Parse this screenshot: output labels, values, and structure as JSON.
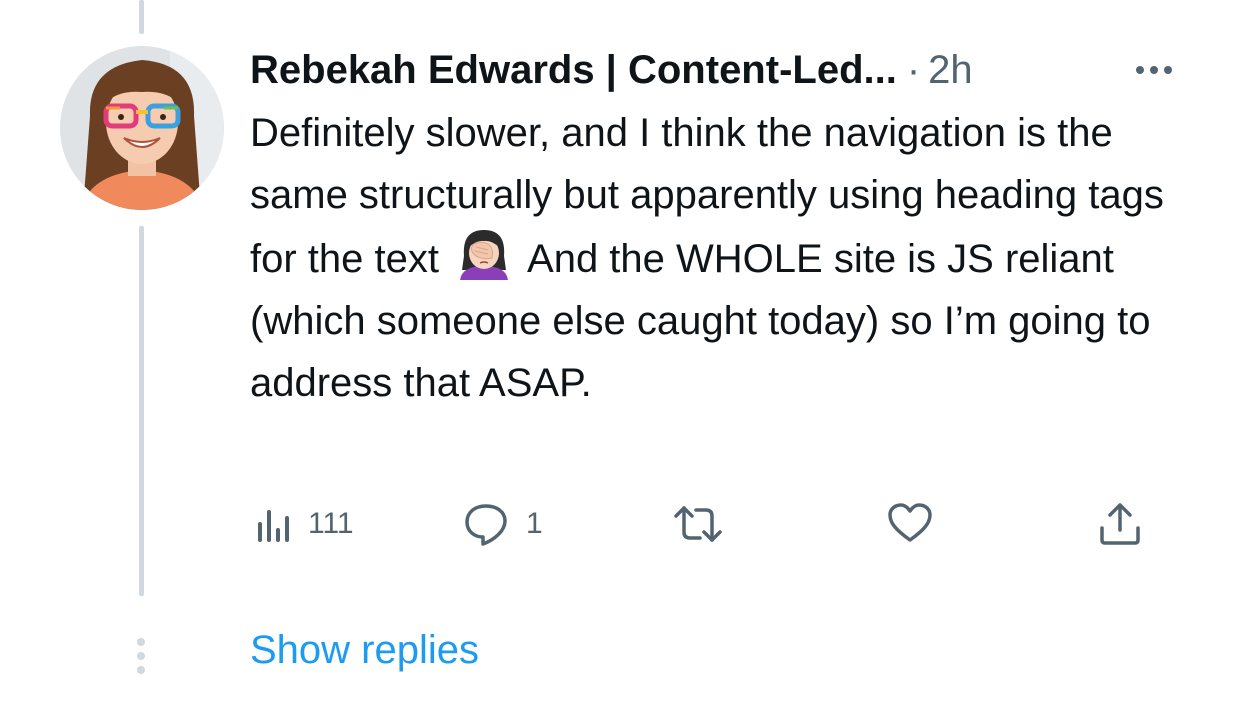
{
  "tweet": {
    "author_name": "Rebekah Edwards | Content-Led...",
    "separator": "·",
    "time": "2h",
    "text_parts": [
      "Definitely slower, and I think the navigation is the same structurally but apparently using heading tags for the text ",
      " And the WHOLE site is JS reliant (which someone else caught today) so I’m going to address that ASAP."
    ],
    "emoji_icon": "woman-facepalming-icon"
  },
  "actions": {
    "views_count": "111",
    "replies_count": "1",
    "retweets_count": "",
    "likes_count": ""
  },
  "thread": {
    "show_replies_label": "Show replies"
  },
  "colors": {
    "text": "#0f1419",
    "secondary": "#536471",
    "link": "#1d9bf0",
    "thread_line": "#cfd9de"
  }
}
